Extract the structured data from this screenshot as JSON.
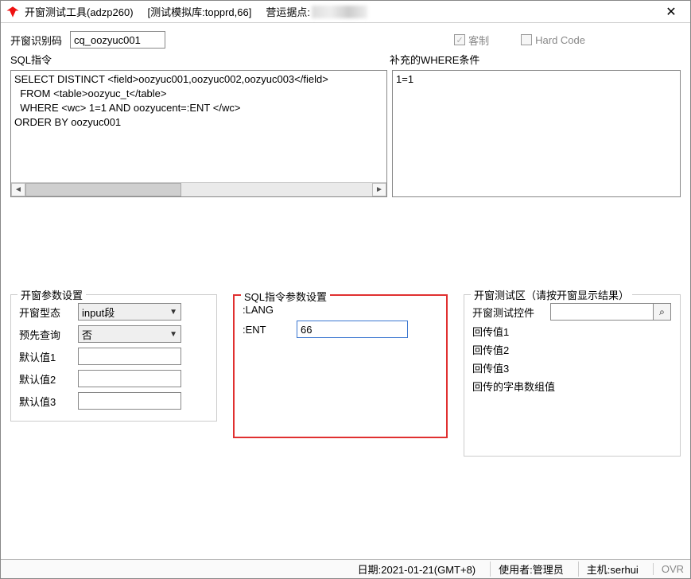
{
  "title": {
    "app": "开窗测试工具(adzp260)",
    "db_prefix": "[测试模拟库:",
    "db_value": "topprd,66",
    "db_suffix": "]",
    "site_label": "营运据点:"
  },
  "row1": {
    "id_label": "开窗识别码",
    "id_value": "cq_oozyuc001",
    "custom_label": "客制",
    "hardcode_label": "Hard Code"
  },
  "sql": {
    "left_label": "SQL指令",
    "right_label": "补充的WHERE条件",
    "left_text": "SELECT DISTINCT <field>oozyuc001,oozyuc002,oozyuc003</field>\n  FROM <table>oozyuc_t</table>\n  WHERE <wc> 1=1 AND oozyucent=:ENT </wc>\nORDER BY oozyuc001",
    "right_text": "1=1"
  },
  "panel1": {
    "legend": "开窗参数设置",
    "type_label": "开窗型态",
    "type_value": "input段",
    "prequery_label": "预先查询",
    "prequery_value": "否",
    "def1_label": "默认值1",
    "def1_value": "",
    "def2_label": "默认值2",
    "def2_value": "",
    "def3_label": "默认值3",
    "def3_value": ""
  },
  "panel2": {
    "legend": "SQL指令参数设置",
    "lang_label": ":LANG",
    "lang_value": "",
    "ent_label": ":ENT",
    "ent_value": "66"
  },
  "panel3": {
    "legend": "开窗测试区（请按开窗显示结果）",
    "widget_label": "开窗测试控件",
    "widget_value": "",
    "ret1": "回传值1",
    "ret2": "回传值2",
    "ret3": "回传值3",
    "retarr": "回传的字串数组值"
  },
  "status": {
    "date_label": "日期:",
    "date_value": "2021-01-21(GMT+8)",
    "user_label": "使用者:",
    "user_value": "管理员",
    "host_label": "主机:",
    "host_value": "serhui",
    "ovr": "OVR"
  }
}
